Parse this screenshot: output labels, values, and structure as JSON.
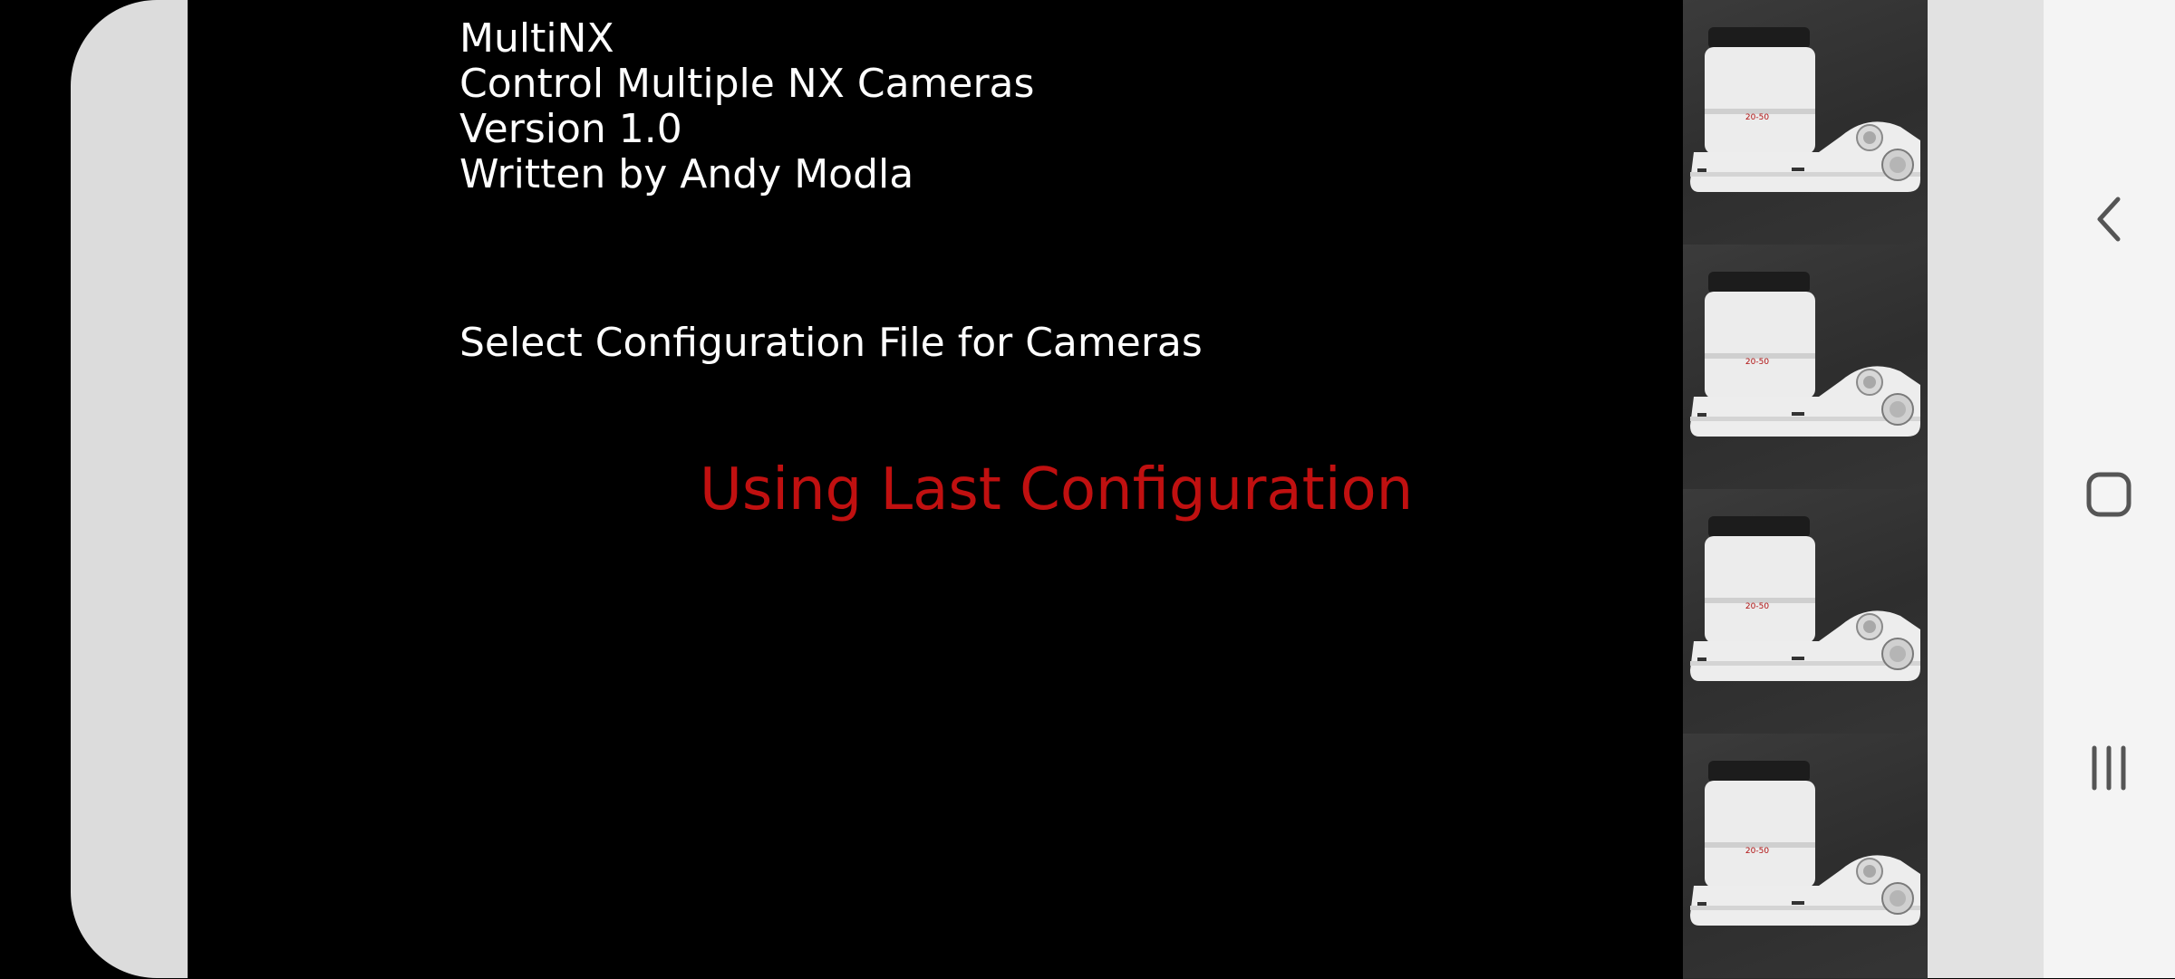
{
  "app": {
    "info_lines": [
      "MultiNX",
      "Control Multiple NX Cameras",
      "Version 1.0",
      "Written by Andy Modla"
    ],
    "select_label": "Select Configuration File for Cameras",
    "status_text": "Using Last Configuration",
    "status_color": "#c01010"
  },
  "camera_strip": {
    "tiles": [
      {
        "lens_label": "20-50"
      },
      {
        "lens_label": "20-50"
      },
      {
        "lens_label": "20-50"
      },
      {
        "lens_label": "20-50"
      }
    ],
    "body_color": "#ececec"
  },
  "navigation": {
    "buttons": [
      {
        "name": "back",
        "icon": "chevron-left-icon"
      },
      {
        "name": "home",
        "icon": "rounded-square-icon"
      },
      {
        "name": "recents",
        "icon": "three-bars-icon"
      }
    ]
  }
}
